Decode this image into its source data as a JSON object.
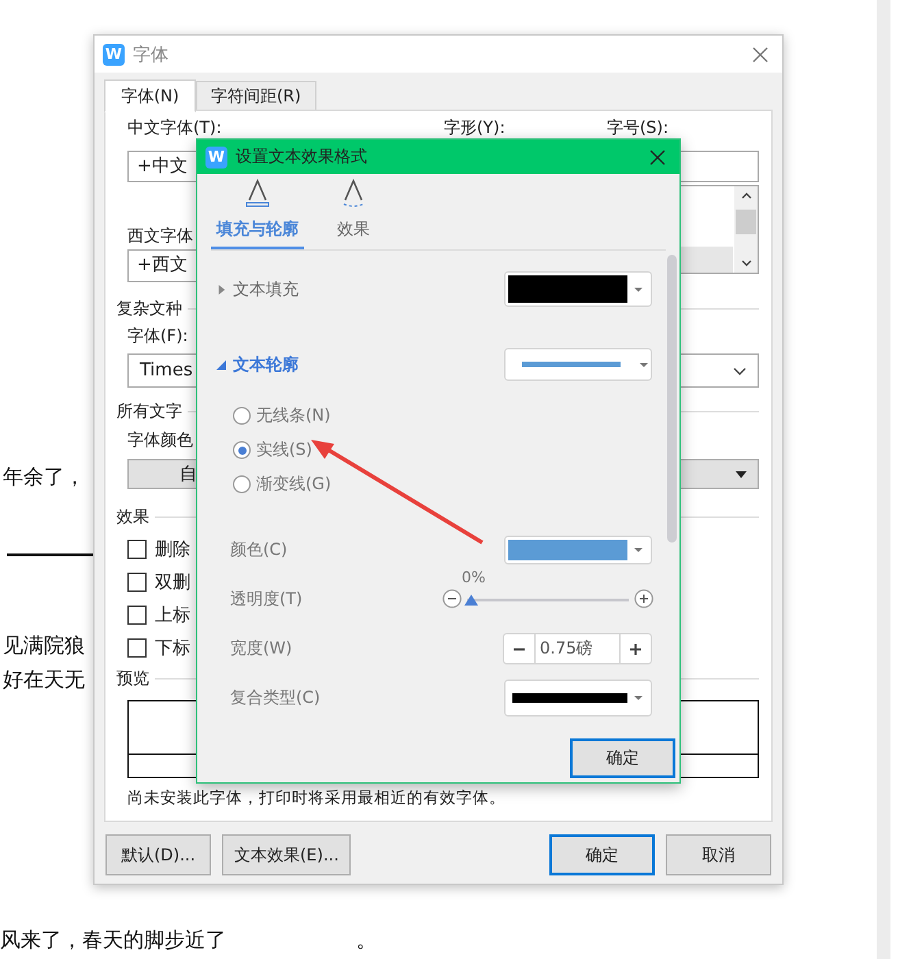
{
  "document": {
    "lines": [
      "年余了，",
      "见满院狼",
      "好在天无",
      "风来了，春天的脚步近了",
      "。"
    ]
  },
  "font_dialog": {
    "icon": "W",
    "title": "字体",
    "tabs": [
      {
        "label": "字体(N)",
        "selected": true
      },
      {
        "label": "字符间距(R)",
        "selected": false
      }
    ],
    "chinese_font": {
      "label": "中文字体(T):",
      "value": "+中文"
    },
    "style_label": "字形(Y):",
    "size_label": "字号(S):",
    "western_font": {
      "label": "西文字体",
      "value": "+西文"
    },
    "complex_script": {
      "heading": "复杂文种",
      "label": "字体(F):",
      "value": "Times"
    },
    "all_text": {
      "heading": "所有文字",
      "color_label": "字体颜色",
      "color_value": "自"
    },
    "effects": {
      "heading": "效果",
      "items": [
        {
          "label": "删除",
          "checked": false
        },
        {
          "label": "双删",
          "checked": false
        },
        {
          "label": "上标",
          "checked": false
        },
        {
          "label": "下标",
          "checked": false
        }
      ]
    },
    "preview": {
      "heading": "预览"
    },
    "note": "尚未安装此字体，打印时将采用最相近的有效字体。",
    "left_buttons": [
      {
        "label": "默认(D)...",
        "default": false
      },
      {
        "label": "文本效果(E)...",
        "default": false
      }
    ],
    "right_buttons": [
      {
        "label": "确定",
        "default": true
      },
      {
        "label": "取消",
        "default": false
      }
    ]
  },
  "effects_dialog": {
    "icon": "W",
    "title": "设置文本效果格式",
    "tabs": [
      {
        "label": "填充与轮廓",
        "kind": "fill",
        "selected": true
      },
      {
        "label": "效果",
        "kind": "effects",
        "selected": false
      }
    ],
    "sections": [
      {
        "label": "文本填充",
        "kind": "fill",
        "expanded": false,
        "color": "#000000"
      },
      {
        "label": "文本轮廓",
        "kind": "line",
        "expanded": true,
        "color": "#5b9bd5",
        "options": [
          {
            "label": "无线条(N)",
            "selected": false
          },
          {
            "label": "实线(S)",
            "selected": true
          },
          {
            "label": "渐变线(G)",
            "selected": false
          }
        ],
        "color_row": {
          "label": "颜色(C)",
          "color": "#5b9bd5"
        },
        "transparency": {
          "label": "透明度(T)",
          "level": 0,
          "reading": "0%"
        },
        "width": {
          "label": "宽度(W)",
          "value": "0.75磅"
        },
        "compound": {
          "label": "复合类型(C)"
        }
      }
    ],
    "ok_button": {
      "label": "确定",
      "default": true
    }
  }
}
